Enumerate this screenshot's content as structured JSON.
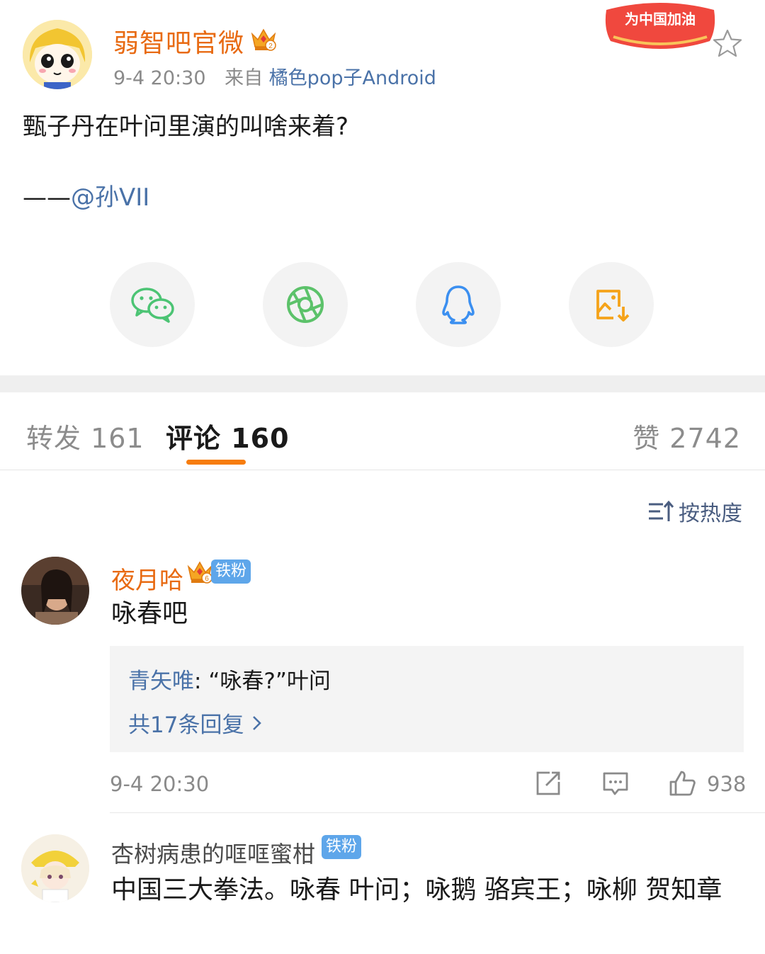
{
  "post": {
    "author_name": "弱智吧官微",
    "time": "9-4 20:30",
    "source_prefix": "来自",
    "source": "橘色pop子Android",
    "promo_badge": "为中国加油",
    "text": "甄子丹在叶问里演的叫啥来着?",
    "signature_prefix": "——",
    "signature_mention": "@孙VII"
  },
  "share": {
    "icons": [
      "wechat-icon",
      "moments-icon",
      "qq-icon",
      "save-image-icon"
    ],
    "colors": {
      "wechat": "#4cc474",
      "moments": "#5cc26a",
      "qq": "#3b8ff0",
      "save": "#f5a31a"
    }
  },
  "tabs": {
    "repost": "转发 161",
    "comment": "评论 160",
    "like": "赞 2742"
  },
  "sort": {
    "label": "按热度"
  },
  "comments": [
    {
      "name": "夜月哈",
      "badge": "铁粉",
      "text": "咏春吧",
      "reply": {
        "author": "青矢唯",
        "separator": ": ",
        "text": "“咏春?”叶问",
        "count_label": "共17条回复"
      },
      "time": "9-4 20:30",
      "likes": "938"
    },
    {
      "name": "杏树病患的哐哐蜜柑",
      "badge": "铁粉",
      "text": "中国三大拳法。咏春 叶问；咏鹅 骆宾王；咏柳 贺知章"
    }
  ],
  "colors": {
    "accent": "#f77d0e",
    "link": "#4a72a8",
    "author": "#e86a12"
  }
}
